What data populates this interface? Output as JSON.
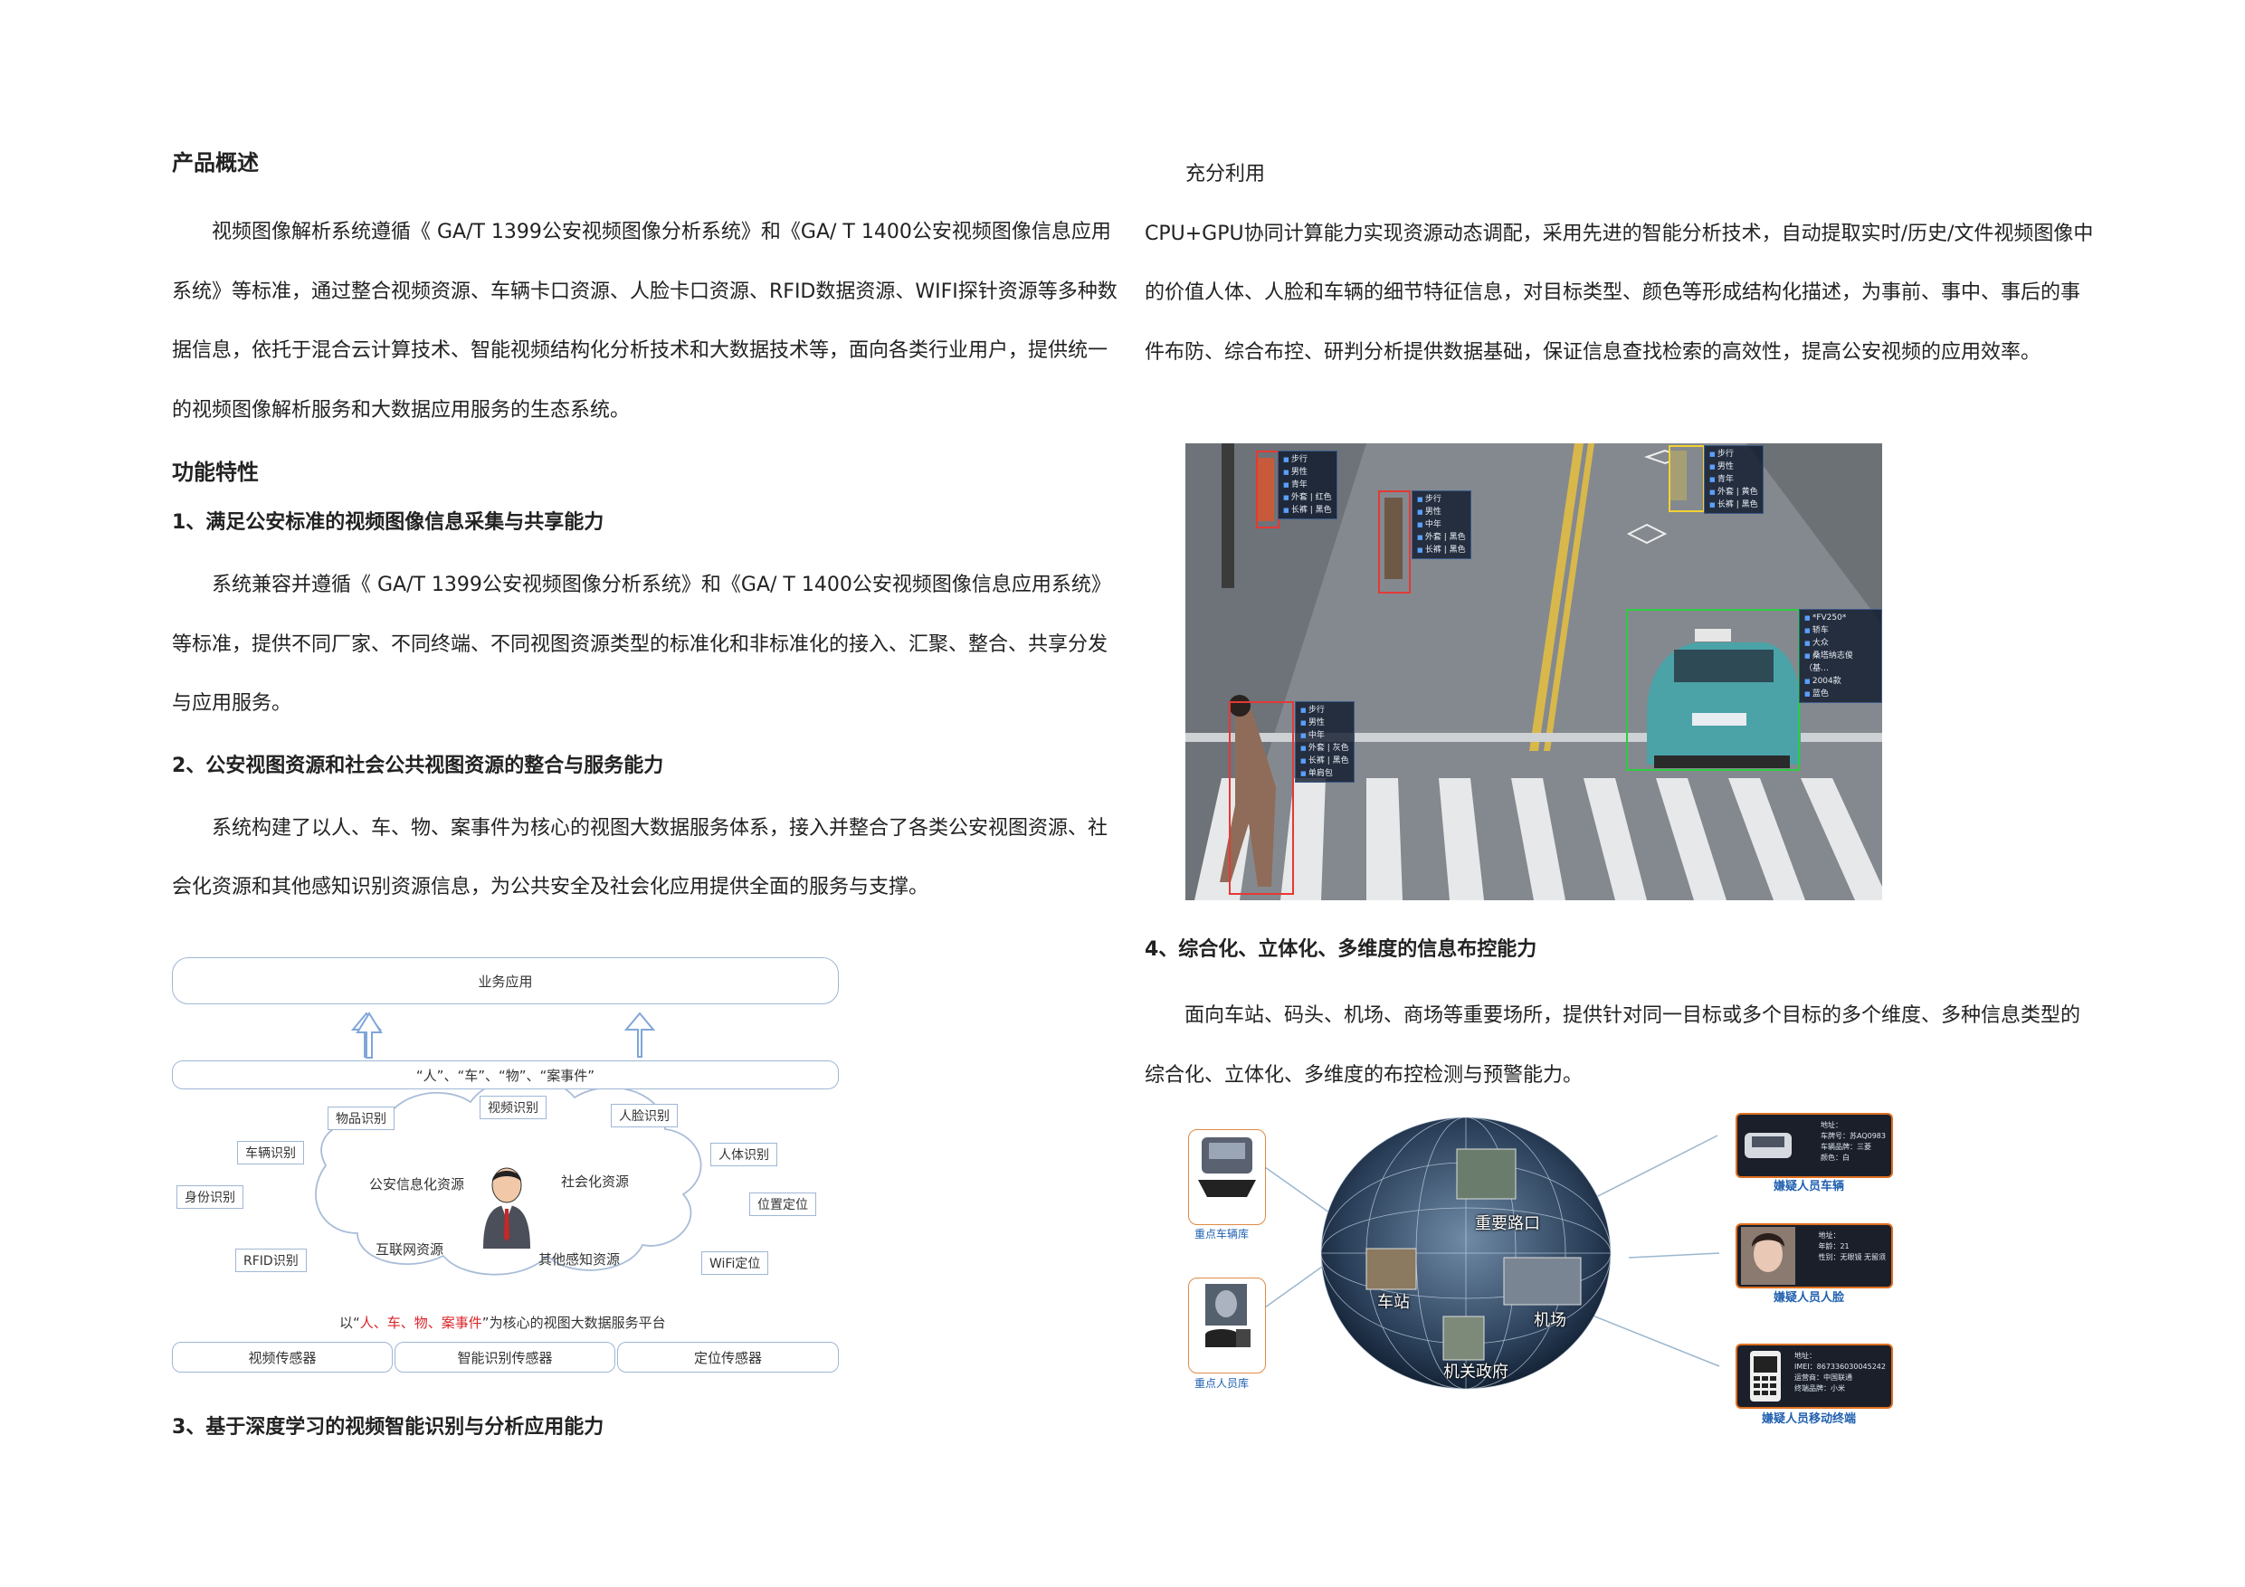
{
  "overview": {
    "title": "产品概述",
    "body": "视频图像解析系统遵循《 GA/T 1399公安视频图像分析系统》和《GA/ T 1400公安视频图像信息应用系统》等标准，通过整合视频资源、车辆卡口资源、人脸卡口资源、RFID数据资源、WIFI探针资源等多种数据信息，依托于混合云计算技术、智能视频结构化分析技术和大数据技术等，面向各类行业用户，提供统一的视频图像解析服务和大数据应用服务的生态系统。"
  },
  "features": {
    "title": "功能特性",
    "f1": {
      "title": "1、满足公安标准的视频图像信息采集与共享能力",
      "body": "系统兼容并遵循《 GA/T 1399公安视频图像分析系统》和《GA/ T 1400公安视频图像信息应用系统》等标准，提供不同厂家、不同终端、不同视图资源类型的标准化和非标准化的接入、汇聚、整合、共享分发与应用服务。"
    },
    "f2": {
      "title": "2、公安视图资源和社会公共视图资源的整合与服务能力",
      "body": "系统构建了以人、车、物、案事件为核心的视图大数据服务体系，接入并整合了各类公安视图资源、社会化资源和其他感知识别资源信息，为公共安全及社会化应用提供全面的服务与支撑。"
    },
    "f3": {
      "title": "3、基于深度学习的视频智能识别与分析应用能力"
    },
    "f3_cont": {
      "lead": "充分利用",
      "body": "CPU+GPU协同计算能力实现资源动态调配，采用先进的智能分析技术，自动提取实时/历史/文件视频图像中的价值人体、人脸和车辆的细节特征信息，对目标类型、颜色等形成结构化描述，为事前、事中、事后的事件布防、综合布控、研判分析提供数据基础，保证信息查找检索的高效性，提高公安视频的应用效率。"
    },
    "f4": {
      "title": "4、综合化、立体化、多维度的信息布控能力",
      "body": "面向车站、码头、机场、商场等重要场所，提供针对同一目标或多个目标的多个维度、多种信息类型的综合化、立体化、多维度的布控检测与预警能力。"
    }
  },
  "diagram": {
    "top": "业务应用",
    "core": "“人”、“车”、“物”、“案事件”",
    "tags": {
      "goods": "物品识别",
      "video": "视频识别",
      "face": "人脸识别",
      "vehicle": "车辆识别",
      "body": "人体识别",
      "id": "身份识别",
      "location": "位置定位",
      "rfid": "RFID识别",
      "wifi": "WiFi定位"
    },
    "cloud": {
      "police": "公安信息化资源",
      "social": "社会化资源",
      "internet": "互联网资源",
      "other": "其他感知资源"
    },
    "platform_prefix": "以“",
    "platform_red": "人、车、物、案事件",
    "platform_suffix": "”为核心的视图大数据服务平台",
    "sensors": [
      "视频传感器",
      "智能识别传感器",
      "定位传感器"
    ]
  },
  "photo": {
    "ped1": [
      "步行",
      "男性",
      "青年",
      "外套 | 红色",
      "长裤 | 黑色"
    ],
    "ped2": [
      "步行",
      "男性",
      "中年",
      "外套 | 黑色",
      "长裤 | 黑色"
    ],
    "ped3": [
      "步行",
      "男性",
      "青年",
      "外套 | 黄色",
      "长裤 | 黑色"
    ],
    "ped4": [
      "步行",
      "男性",
      "中年",
      "外套 | 灰色",
      "长裤 | 黑色",
      "单肩包"
    ],
    "car": [
      "*FV250*",
      "轿车",
      "大众",
      "桑塔纳志俊（基…",
      "2004款",
      "蓝色"
    ]
  },
  "globe": {
    "left_top": "重点车辆库",
    "left_bottom": "重点人员库",
    "labels": {
      "crossing": "重要路口",
      "station": "车站",
      "airport": "机场",
      "government": "机关政府"
    },
    "right": {
      "car_caption": "嫌疑人员车辆",
      "face_caption": "嫌疑人员人脸",
      "phone_caption": "嫌疑人员移动终端",
      "car_lines": [
        "地址：",
        "车牌号：苏AQ0983",
        "车辆品牌：三菱",
        "颜色：白"
      ],
      "face_lines": [
        "地址：",
        "年龄：21",
        "性别：无眼镜  无留须"
      ],
      "phone_lines": [
        "地址：",
        "IMEI：867336030045242",
        "运营商：中国联通",
        "终端品牌：小米"
      ]
    }
  },
  "colors": {
    "accent_red": "#d9242b",
    "box_red": "#e53935",
    "box_green": "#2ecc40",
    "box_yellow": "#f2d233",
    "caption_blue": "#2060b0"
  }
}
